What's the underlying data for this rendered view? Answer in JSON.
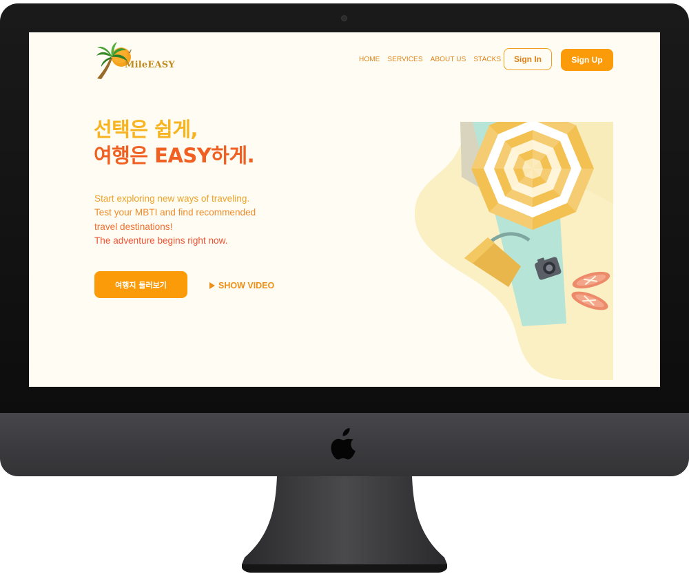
{
  "brand": {
    "name": "MileEASY",
    "accent": "#fc9b0a",
    "headline_yellow": "#f7b420",
    "headline_red": "#f06022"
  },
  "nav": {
    "items": [
      "HOME",
      "SERVICES",
      "ABOUT US",
      "STACKS"
    ],
    "sign_in": "Sign In",
    "sign_up": "Sign Up"
  },
  "hero": {
    "headline_line1": "선택은 쉽게,",
    "headline_line2": "여행은 EASY하게.",
    "description": [
      "Start exploring new ways of traveling.",
      "Test your MBTI and find recommended",
      "travel destinations!",
      "The adventure begins right now."
    ],
    "cta_label": "여행지 둘러보기",
    "video_label": "SHOW VIDEO"
  },
  "icons": {
    "logo": "palm-tree-sun-icon",
    "play": "play-icon",
    "apple": "apple-icon",
    "illustration": "beach-umbrella-illustration"
  }
}
